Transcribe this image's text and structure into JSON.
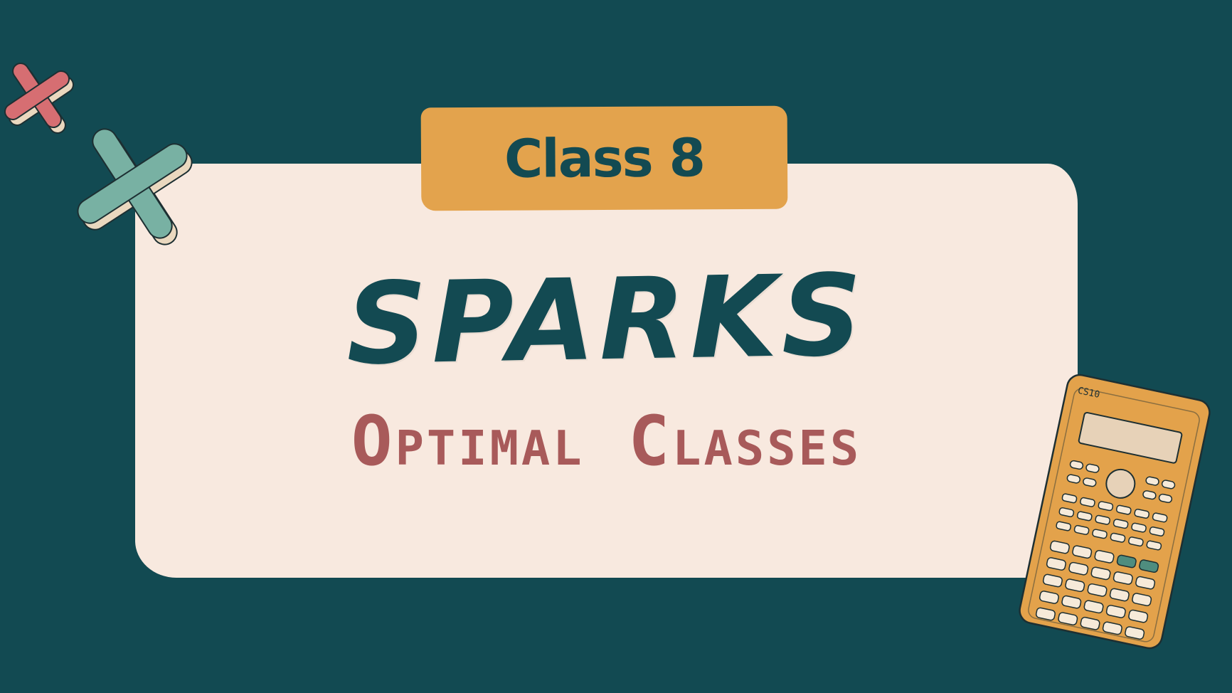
{
  "colors": {
    "background": "#124a52",
    "card": "#f8e9df",
    "badge": "#e3a34d",
    "title": "#134a52",
    "subtitle": "#a85a5a",
    "cross_pink": "#d66e72",
    "cross_teal": "#78b1a3",
    "cross_shadow": "#ead8bf",
    "calculator_body": "#e3a24b",
    "calculator_screen": "#e7d2b8",
    "calculator_key": "#f6ead9",
    "calculator_green_key": "#4f8d7f",
    "outline": "#1d2f32"
  },
  "badge": {
    "text": "Class 8"
  },
  "title": {
    "text": "SPARKS"
  },
  "subtitle": {
    "text": "Optimal Classes"
  },
  "calculator": {
    "brand": "CS10"
  },
  "icons": {
    "cross_one": "cross-icon",
    "cross_two": "cross-icon",
    "calculator": "calculator-icon"
  }
}
